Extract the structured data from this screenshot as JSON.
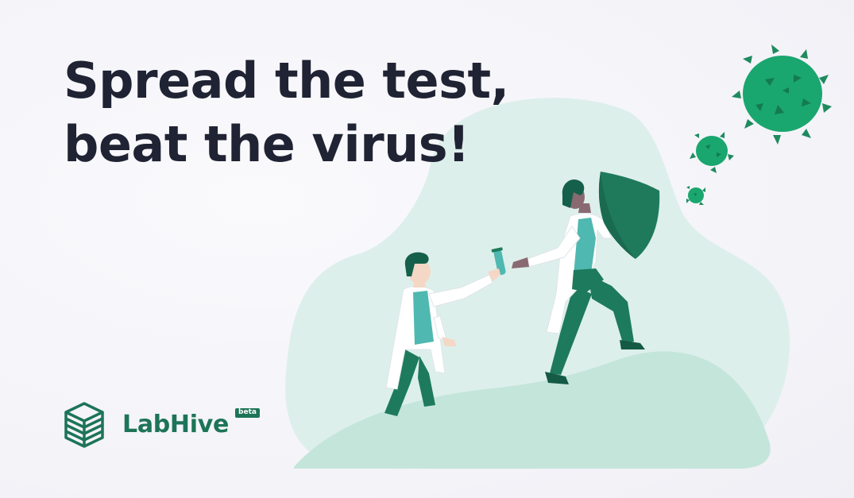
{
  "headline": {
    "line1": "Spread the test,",
    "line2": "beat the virus!"
  },
  "brand": {
    "name": "LabHive",
    "badge": "beta",
    "logo_icon": "stacked-layers-logo"
  },
  "illustration": {
    "scene": "two scientists handing over a test tube, one holding a shield against virus particles",
    "icons": [
      "virus-icon",
      "shield-icon",
      "test-tube-icon"
    ]
  },
  "colors": {
    "background": "#f5f5f9",
    "headline_text": "#1f2333",
    "brand_green": "#1d7457",
    "accent_teal": "#4fb8b0",
    "virus_green": "#1aa66f",
    "blob_light": "#dceeea",
    "hill": "#c5e6dc"
  }
}
